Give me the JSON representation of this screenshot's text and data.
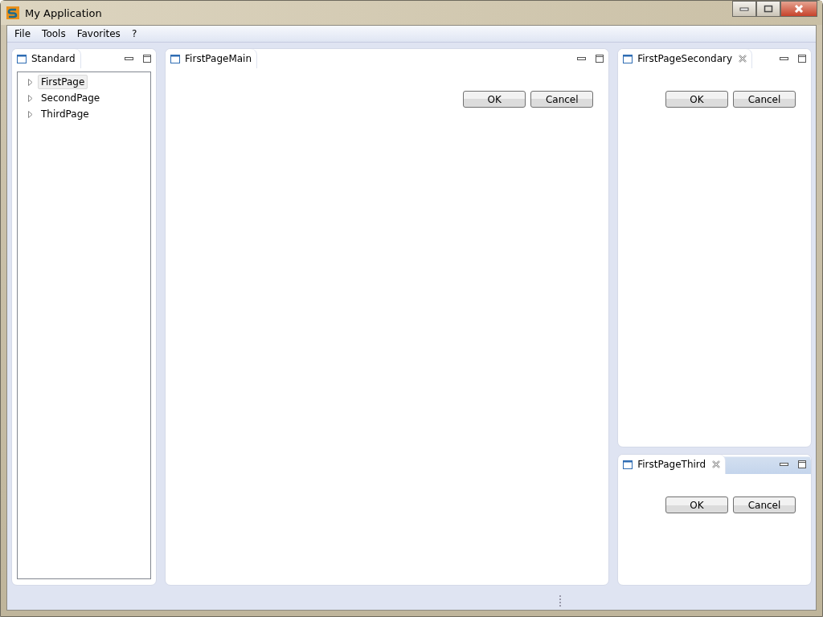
{
  "window": {
    "title": "My Application"
  },
  "menu": [
    "File",
    "Tools",
    "Favorites",
    "?"
  ],
  "navigator": {
    "tab": {
      "label": "Standard",
      "closable": false,
      "active": false
    },
    "tree": [
      {
        "label": "FirstPage",
        "selected": true,
        "expanded": false
      },
      {
        "label": "SecondPage",
        "selected": false,
        "expanded": false
      },
      {
        "label": "ThirdPage",
        "selected": false,
        "expanded": false
      }
    ]
  },
  "views": [
    {
      "tab": {
        "label": "FirstPageMain",
        "closable": false,
        "active": false
      },
      "buttons": [
        "OK",
        "Cancel"
      ]
    },
    {
      "tab": {
        "label": "FirstPageSecondary",
        "closable": true,
        "active": false
      },
      "buttons": [
        "OK",
        "Cancel"
      ]
    },
    {
      "tab": {
        "label": "FirstPageThird",
        "closable": true,
        "active": true
      },
      "buttons": [
        "OK",
        "Cancel"
      ]
    }
  ]
}
